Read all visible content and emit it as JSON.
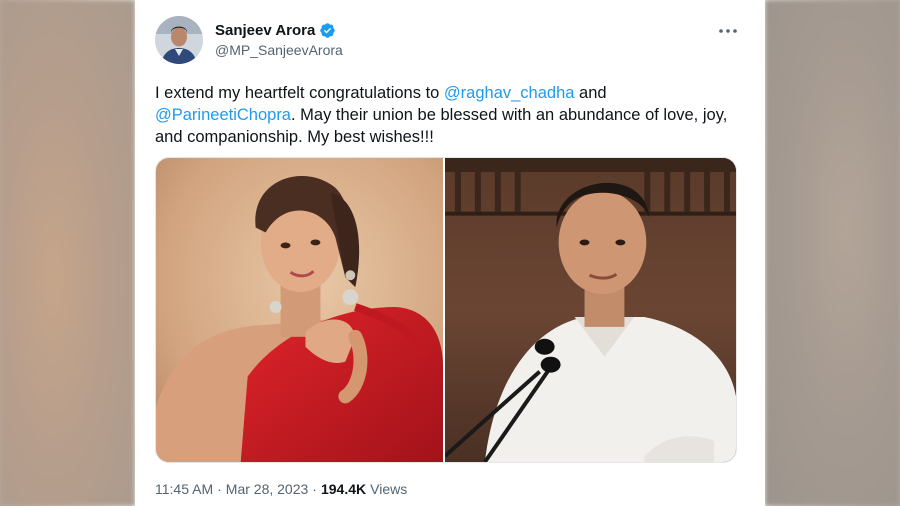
{
  "tweet": {
    "author": {
      "display_name": "Sanjeev Arora",
      "handle": "@MP_SanjeevArora",
      "verified": true
    },
    "text": {
      "part1": "I extend my heartfelt congratulations to ",
      "mention1": "@raghav_chadha",
      "part2": " and ",
      "mention2": "@ParineetiChopra",
      "part3": ". May their union be blessed with an abundance of love, joy, and companionship. My best wishes!!!"
    },
    "meta": {
      "time": "11:45 AM",
      "separator1": "·",
      "date": "Mar 28, 2023",
      "separator2": "·",
      "views_count": "194.4K",
      "views_label": "Views"
    }
  },
  "icons": {
    "verified": "verified-badge-icon",
    "more": "more-options-icon"
  },
  "colors": {
    "link": "#1d9bf0",
    "text": "#0f1419",
    "secondary": "#536471",
    "verified": "#1d9bf0"
  }
}
